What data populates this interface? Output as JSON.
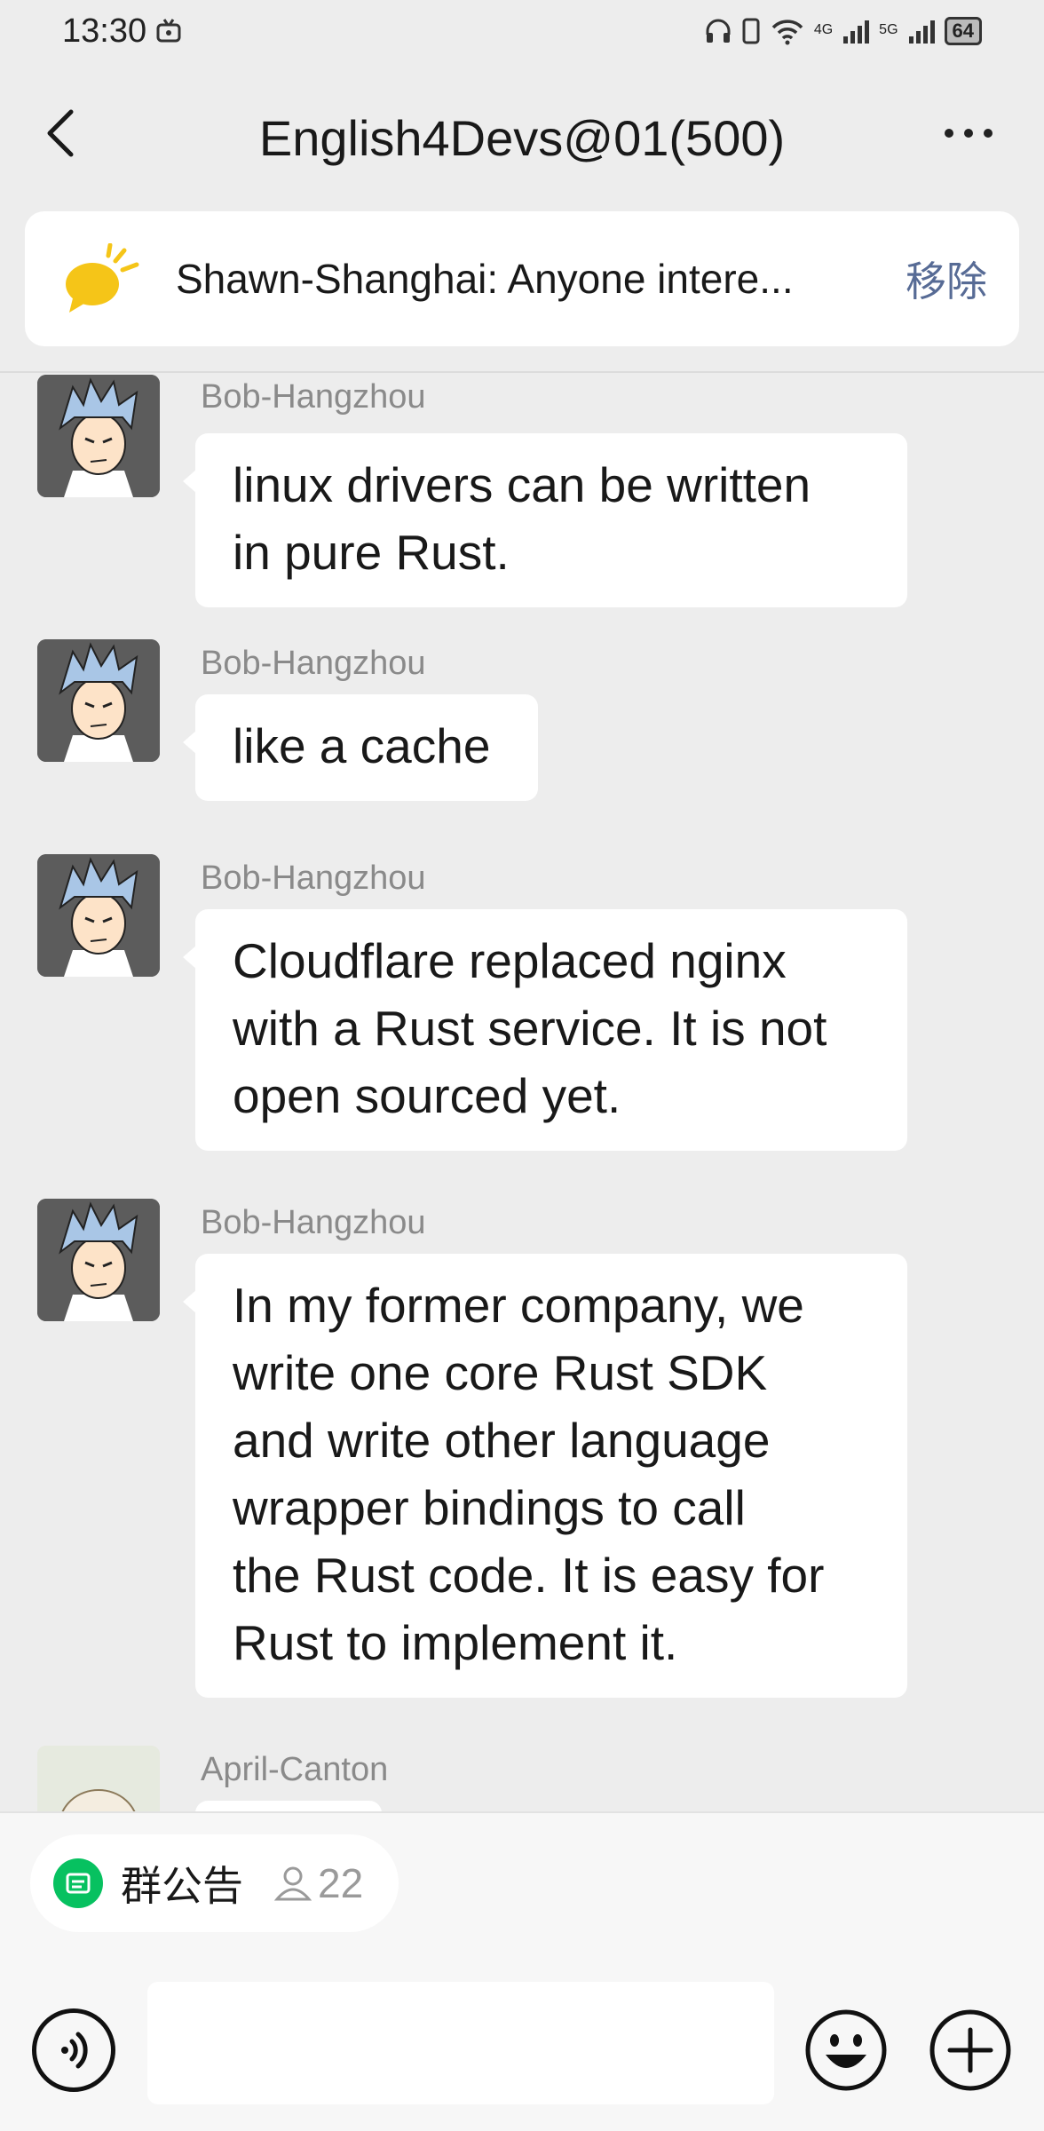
{
  "status_bar": {
    "time": "13:30",
    "network_1": "4G",
    "network_2": "5G",
    "battery": "64"
  },
  "header": {
    "title": "English4Devs@01(500)"
  },
  "pinned": {
    "text": "Shawn-Shanghai: Anyone intere...",
    "remove_label": "移除"
  },
  "messages": [
    {
      "sender": "Bob-Hangzhou",
      "lines": [
        "linux drivers can be written",
        "in pure Rust."
      ]
    },
    {
      "sender": "Bob-Hangzhou",
      "lines": [
        "like a cache"
      ]
    },
    {
      "sender": "Bob-Hangzhou",
      "lines": [
        "Cloudflare replaced nginx",
        "with a Rust service. It is not",
        "open sourced yet."
      ]
    },
    {
      "sender": "Bob-Hangzhou",
      "lines": [
        "In my former company, we",
        "write one core Rust SDK",
        "and write other language",
        "wrapper bindings to call",
        "the Rust code. It is easy for",
        "Rust to implement it."
      ]
    },
    {
      "sender": "April-Canton",
      "lines": []
    }
  ],
  "bottom": {
    "announcement_label": "群公告",
    "member_count": "22"
  },
  "colors": {
    "background": "#ededed",
    "bubble": "#ffffff",
    "link": "#576b95",
    "accent_green": "#07c160"
  }
}
